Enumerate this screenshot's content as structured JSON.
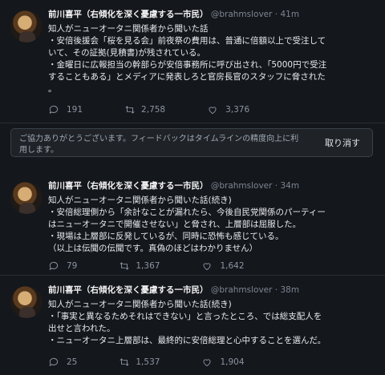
{
  "tweets": [
    {
      "author": "前川喜平（右傾化を深く憂慮する一市民）",
      "handle": "@brahmslover",
      "separator": "·",
      "time": "41m",
      "lines": [
        "知人がニューオータニ関係者から聞いた話",
        "・安倍後援会「桜を見る会」前夜祭の費用は、普通に倍額以上で受注して",
        "いて、その証拠(見積書)が残されている。",
        "・金曜日に広報担当の幹部らが安倍事務所に呼び出され、「5000円で受注",
        "することもある」とメディアに発表しろと官房長官のスタッフに脅された",
        "。"
      ],
      "replies": "191",
      "retweets": "2,758",
      "likes": "3,376"
    },
    {
      "author": "前川喜平（右傾化を深く憂慮する一市民）",
      "handle": "@brahmslover",
      "separator": "·",
      "time": "34m",
      "lines": [
        "知人がニューオータニ関係者から聞いた話(続き)",
        "・安倍総理側から「余計なことが漏れたら、今後自民党関係のパーティー",
        "はニューオータニで開催させない」と脅され、上層部は屈服した。",
        "・現場は上層部に反発しているが、同時に恐怖も感じている。",
        "（以上は伝聞の伝聞です。真偽のほどはわかりません）"
      ],
      "replies": "79",
      "retweets": "1,367",
      "likes": "1,642"
    },
    {
      "author": "前川喜平（右傾化を深く憂慮する一市民）",
      "handle": "@brahmslover",
      "separator": "·",
      "time": "38m",
      "lines": [
        "知人がニューオータニ関係者から聞いた話(続き)",
        "・「事実と異なるためそれはできない」と言ったところ、では総支配人を",
        "出せと言われた。",
        "・ニューオータニ上層部は、最終的に安倍総理と心中することを選んだ。"
      ],
      "replies": "25",
      "retweets": "1,537",
      "likes": "1,904"
    }
  ],
  "feedback": {
    "message": "ご協力ありがとうございます。フィードバックはタイムラインの精度向上に利用します。",
    "button": "取り消す"
  },
  "icons": {
    "reply": "reply-icon",
    "retweet": "retweet-icon",
    "like": "heart-icon"
  },
  "colors": {
    "background": "#14171c",
    "text": "#e4e6e9",
    "muted": "#8b95a1"
  }
}
